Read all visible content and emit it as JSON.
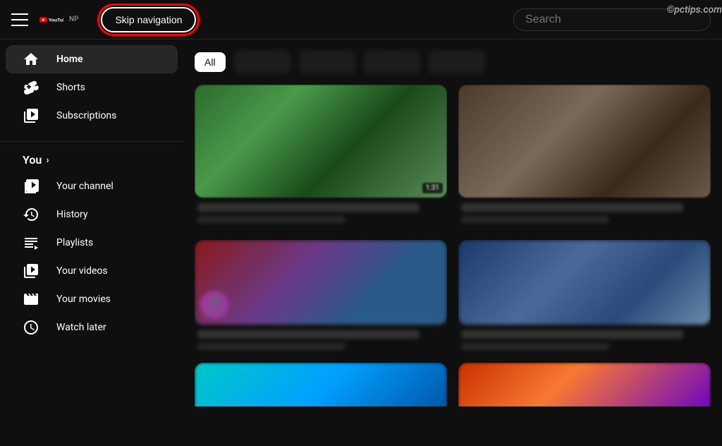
{
  "header": {
    "menu_icon_label": "Menu",
    "logo_text": "YouTube",
    "logo_np": "NP",
    "skip_nav_label": "Skip navigation",
    "search_placeholder": "Search",
    "watermark": "©pctips.com"
  },
  "sidebar": {
    "main_items": [
      {
        "id": "home",
        "label": "Home",
        "icon": "home"
      },
      {
        "id": "shorts",
        "label": "Shorts",
        "icon": "shorts"
      },
      {
        "id": "subscriptions",
        "label": "Subscriptions",
        "icon": "subscriptions"
      }
    ],
    "you_section_label": "You",
    "you_items": [
      {
        "id": "your-channel",
        "label": "Your channel",
        "icon": "channel"
      },
      {
        "id": "history",
        "label": "History",
        "icon": "history"
      },
      {
        "id": "playlists",
        "label": "Playlists",
        "icon": "playlists"
      },
      {
        "id": "your-videos",
        "label": "Your videos",
        "icon": "video"
      },
      {
        "id": "your-movies",
        "label": "Your movies",
        "icon": "movies"
      },
      {
        "id": "watch-later",
        "label": "Watch later",
        "icon": "clock"
      }
    ]
  },
  "filter_chips": [
    {
      "id": "all",
      "label": "All",
      "active": true
    },
    {
      "id": "chip2",
      "label": "",
      "blurred": true
    },
    {
      "id": "chip3",
      "label": "",
      "blurred": true
    },
    {
      "id": "chip4",
      "label": "",
      "blurred": true
    },
    {
      "id": "chip5",
      "label": "",
      "blurred": true
    }
  ],
  "videos": [
    {
      "id": "v1",
      "duration": "1:31",
      "theme": "nature"
    },
    {
      "id": "v2",
      "theme": "person"
    },
    {
      "id": "v3",
      "theme": "purple"
    },
    {
      "id": "v4",
      "theme": "dark-text"
    },
    {
      "id": "v5",
      "theme": "cyan"
    },
    {
      "id": "v6",
      "theme": "red-purple"
    }
  ]
}
